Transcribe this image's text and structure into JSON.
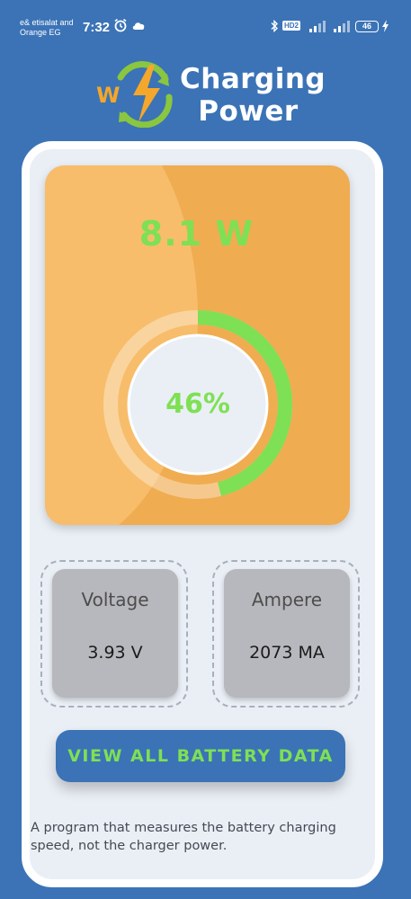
{
  "status_bar": {
    "carrier_line1": "e& etisalat and",
    "carrier_line2": "Orange EG",
    "time": "7:32",
    "hd_label": "HD2",
    "battery_level": "46",
    "icons": [
      "alarm-icon",
      "cloud-message-icon",
      "bluetooth-icon",
      "signal-icon",
      "signal-icon",
      "battery-icon",
      "charging-bolt-icon"
    ]
  },
  "header": {
    "logo_letter": "W",
    "title_line1": "Charging",
    "title_line2": "Power",
    "logo_icon": "charging-power-logo-icon"
  },
  "power_panel": {
    "watts": "8.1 W",
    "percent_label": "46%",
    "charge_fraction": 0.46
  },
  "stats": {
    "voltage": {
      "label": "Voltage",
      "value": "3.93 V"
    },
    "ampere": {
      "label": "Ampere",
      "value": "2073 MA"
    }
  },
  "actions": {
    "view_all_label": "VIEW ALL BATTERY DATA"
  },
  "footer": {
    "note": "A program that measures the battery charging speed, not the charger power."
  },
  "colors": {
    "background": "#3b73b6",
    "panel": "#f0ac50",
    "accent_green": "#7ee054",
    "card": "#eaeff6",
    "stat_box": "#b7b8bd"
  }
}
